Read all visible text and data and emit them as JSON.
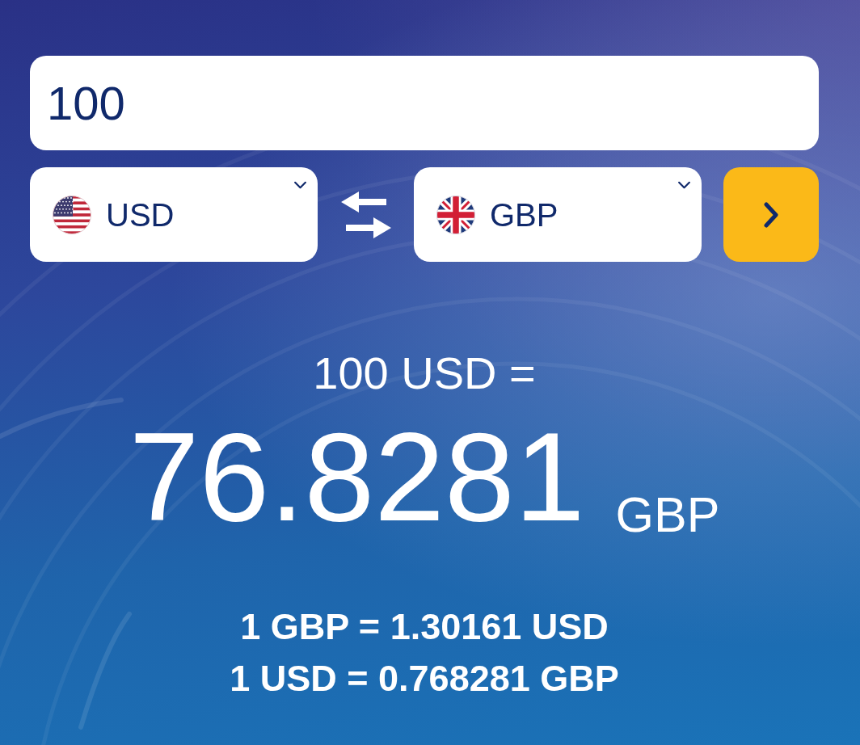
{
  "amount_field": {
    "value": "100"
  },
  "currencies": [
    {
      "code": "USD",
      "kind": "usa"
    },
    {
      "code": "GBP",
      "kind": "uk"
    }
  ],
  "result": {
    "source": "100 USD =",
    "amount": "76.8281",
    "currency": "GBP"
  },
  "rates": [
    "1 GBP = 1.30161 USD",
    "1 USD = 0.768281 GBP"
  ]
}
